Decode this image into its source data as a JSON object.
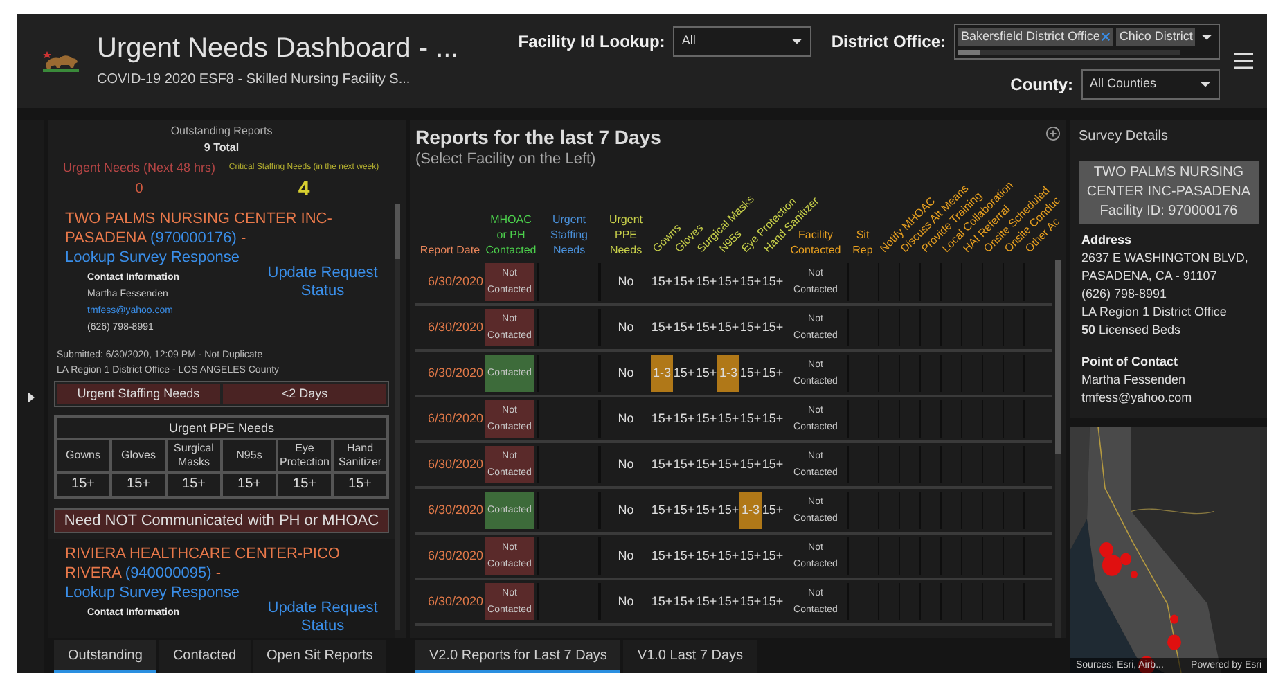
{
  "header": {
    "title": "Urgent Needs Dashboard - ...",
    "subtitle": "COVID-19 2020 ESF8 - Skilled Nursing Facility S...",
    "filters": [
      {
        "kind": "select",
        "label": "Facility Id Lookup:",
        "value": "All"
      },
      {
        "kind": "multiselect",
        "label": "District Office:",
        "chips": [
          "Bakersfield District Office",
          "Chico District"
        ]
      },
      {
        "kind": "select",
        "label": "County:",
        "value": "All Counties"
      }
    ]
  },
  "left_panel": {
    "summary": {
      "title": "Outstanding Reports",
      "total": "9 Total",
      "urgent_label": "Urgent Needs (Next 48 hrs)",
      "urgent_count": "0",
      "critical_label": "Critical Staffing Needs (in the next week)",
      "critical_count": "4"
    },
    "facilities": [
      {
        "name": "TWO PALMS NURSING CENTER INC-PASADENA",
        "id": "(970000176)",
        "separator": "-",
        "link": "Lookup Survey Response",
        "action": "Update Request Status",
        "contact_heading": "Contact Information",
        "contact_name": "Martha Fessenden",
        "email": "tmfess@yahoo.com",
        "phone": "(626) 798-8991",
        "submitted": "Submitted: 6/30/2020, 12:09 PM - Not Duplicate",
        "office": "LA Region 1 District Office - LOS ANGELES County",
        "staffing": [
          "Urgent Staffing Needs",
          "<2 Days"
        ],
        "ppe_title": "Urgent PPE Needs",
        "ppe_columns": [
          "Gowns",
          "Gloves",
          "Surgical Masks",
          "N95s",
          "Eye Protection",
          "Hand Sanitizer"
        ],
        "ppe_values": [
          "15+",
          "15+",
          "15+",
          "15+",
          "15+",
          "15+"
        ],
        "communication": "Need NOT Communicated with PH or MHOAC"
      },
      {
        "name": "RIVIERA HEALTHCARE CENTER-PICO RIVERA",
        "id": "(940000095)",
        "separator": "-",
        "link": "Lookup Survey Response",
        "action": "Update Request Status",
        "contact_heading": "Contact Information"
      }
    ],
    "tabs": [
      {
        "label": "Outstanding",
        "selected": true
      },
      {
        "label": "Contacted",
        "selected": false
      },
      {
        "label": "Open Sit Reports",
        "selected": false
      }
    ]
  },
  "reports": {
    "title": "Reports for the last 7 Days",
    "subtitle": "(Select Facility on the Left)",
    "columns": [
      {
        "kind": "date",
        "label": "Report Date"
      },
      {
        "kind": "contact",
        "label": "MHOAC or PH Contacted"
      },
      {
        "kind": "staffing",
        "label": "Urgent Staffing Needs"
      },
      {
        "kind": "ppe",
        "label": "Urgent PPE Needs"
      },
      {
        "kind": "ppe_item",
        "label": "Gowns"
      },
      {
        "kind": "ppe_item",
        "label": "Gloves"
      },
      {
        "kind": "ppe_item",
        "label": "Surgical Masks"
      },
      {
        "kind": "ppe_item",
        "label": "N95s"
      },
      {
        "kind": "ppe_item",
        "label": "Eye Protection"
      },
      {
        "kind": "ppe_item",
        "label": "Hand Sanitizer"
      },
      {
        "kind": "facility",
        "label": "Facility Contacted"
      },
      {
        "kind": "sitrep",
        "label": "Sit Rep"
      },
      {
        "kind": "action",
        "label": "Notify MHOAC"
      },
      {
        "kind": "action",
        "label": "Discuss Alt Means"
      },
      {
        "kind": "action",
        "label": "Provide Training"
      },
      {
        "kind": "action",
        "label": "Local Collaboration"
      },
      {
        "kind": "action",
        "label": "HAI Referral"
      },
      {
        "kind": "action",
        "label": "Onsite Scheduled"
      },
      {
        "kind": "action",
        "label": "Onsite Conduc"
      },
      {
        "kind": "action",
        "label": "Other Ac"
      }
    ],
    "rows": [
      {
        "date": "6/30/2020",
        "contacted": false,
        "contact_status": "Not Contacted",
        "ppe_needs": "No",
        "ppe": [
          {
            "value": "15+",
            "urgent": false
          },
          {
            "value": "15+",
            "urgent": false
          },
          {
            "value": "15+",
            "urgent": false
          },
          {
            "value": "15+",
            "urgent": false
          },
          {
            "value": "15+",
            "urgent": false
          },
          {
            "value": "15+",
            "urgent": false
          }
        ],
        "facility_contacted": "Not Contacted"
      },
      {
        "date": "6/30/2020",
        "contacted": false,
        "contact_status": "Not Contacted",
        "ppe_needs": "No",
        "ppe": [
          {
            "value": "15+",
            "urgent": false
          },
          {
            "value": "15+",
            "urgent": false
          },
          {
            "value": "15+",
            "urgent": false
          },
          {
            "value": "15+",
            "urgent": false
          },
          {
            "value": "15+",
            "urgent": false
          },
          {
            "value": "15+",
            "urgent": false
          }
        ],
        "facility_contacted": "Not Contacted"
      },
      {
        "date": "6/30/2020",
        "contacted": true,
        "contact_status": "Contacted",
        "ppe_needs": "No",
        "ppe": [
          {
            "value": "1-3",
            "urgent": true
          },
          {
            "value": "15+",
            "urgent": false
          },
          {
            "value": "15+",
            "urgent": false
          },
          {
            "value": "1-3",
            "urgent": true
          },
          {
            "value": "15+",
            "urgent": false
          },
          {
            "value": "15+",
            "urgent": false
          }
        ],
        "facility_contacted": "Not Contacted"
      },
      {
        "date": "6/30/2020",
        "contacted": false,
        "contact_status": "Not Contacted",
        "ppe_needs": "No",
        "ppe": [
          {
            "value": "15+",
            "urgent": false
          },
          {
            "value": "15+",
            "urgent": false
          },
          {
            "value": "15+",
            "urgent": false
          },
          {
            "value": "15+",
            "urgent": false
          },
          {
            "value": "15+",
            "urgent": false
          },
          {
            "value": "15+",
            "urgent": false
          }
        ],
        "facility_contacted": "Not Contacted"
      },
      {
        "date": "6/30/2020",
        "contacted": false,
        "contact_status": "Not Contacted",
        "ppe_needs": "No",
        "ppe": [
          {
            "value": "15+",
            "urgent": false
          },
          {
            "value": "15+",
            "urgent": false
          },
          {
            "value": "15+",
            "urgent": false
          },
          {
            "value": "15+",
            "urgent": false
          },
          {
            "value": "15+",
            "urgent": false
          },
          {
            "value": "15+",
            "urgent": false
          }
        ],
        "facility_contacted": "Not Contacted"
      },
      {
        "date": "6/30/2020",
        "contacted": true,
        "contact_status": "Contacted",
        "ppe_needs": "No",
        "ppe": [
          {
            "value": "15+",
            "urgent": false
          },
          {
            "value": "15+",
            "urgent": false
          },
          {
            "value": "15+",
            "urgent": false
          },
          {
            "value": "15+",
            "urgent": false
          },
          {
            "value": "1-3",
            "urgent": true
          },
          {
            "value": "15+",
            "urgent": false
          }
        ],
        "facility_contacted": "Not Contacted"
      },
      {
        "date": "6/30/2020",
        "contacted": false,
        "contact_status": "Not Contacted",
        "ppe_needs": "No",
        "ppe": [
          {
            "value": "15+",
            "urgent": false
          },
          {
            "value": "15+",
            "urgent": false
          },
          {
            "value": "15+",
            "urgent": false
          },
          {
            "value": "15+",
            "urgent": false
          },
          {
            "value": "15+",
            "urgent": false
          },
          {
            "value": "15+",
            "urgent": false
          }
        ],
        "facility_contacted": "Not Contacted"
      },
      {
        "date": "6/30/2020",
        "contacted": false,
        "contact_status": "Not Contacted",
        "ppe_needs": "No",
        "ppe": [
          {
            "value": "15+",
            "urgent": false
          },
          {
            "value": "15+",
            "urgent": false
          },
          {
            "value": "15+",
            "urgent": false
          },
          {
            "value": "15+",
            "urgent": false
          },
          {
            "value": "15+",
            "urgent": false
          },
          {
            "value": "15+",
            "urgent": false
          }
        ],
        "facility_contacted": "Not Contacted"
      }
    ],
    "tabs": [
      {
        "label": "V2.0 Reports for Last 7 Days",
        "selected": true
      },
      {
        "label": "V1.0 Last 7 Days",
        "selected": false
      }
    ]
  },
  "survey_details": {
    "title": "Survey Details",
    "facility_name": "TWO PALMS NURSING CENTER INC-PASADENA",
    "facility_id": "Facility ID: 970000176",
    "address_heading": "Address",
    "address_lines": [
      "2637 E WASHINGTON BLVD,",
      "PASADENA, CA - 91107",
      "(626) 798-8991",
      "LA Region 1 District Office"
    ],
    "beds": "**50** Licensed Beds",
    "contact_heading": "Point of Contact",
    "contact_name": "Martha Fessenden",
    "contact_email": "tmfess@yahoo.com"
  },
  "map": {
    "attribution": [
      "Sources: Esri, Airb...",
      "Powered by Esri"
    ]
  }
}
